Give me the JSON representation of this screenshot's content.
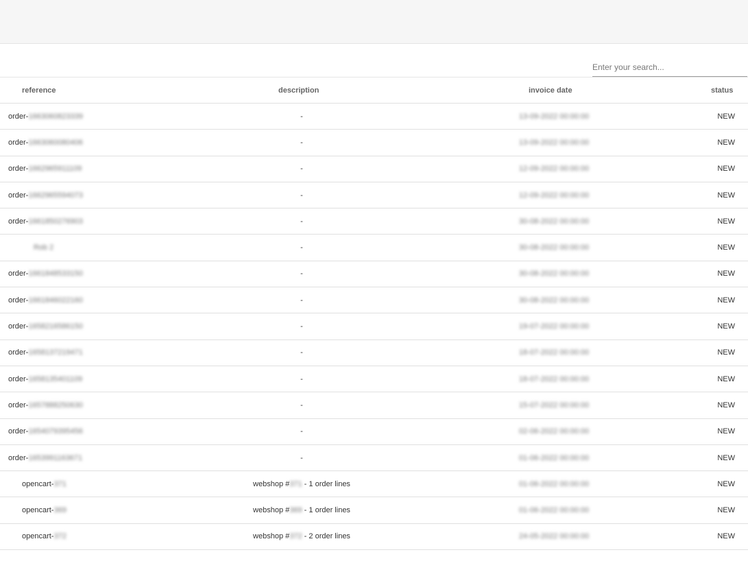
{
  "search": {
    "placeholder": "Enter your search..."
  },
  "table": {
    "columns": {
      "reference": "reference",
      "description": "description",
      "invoice_date": "invoice date",
      "status": "status"
    },
    "rows": [
      {
        "ref_prefix": "order-",
        "ref_hidden": "1663060823339",
        "desc": "-",
        "date": "13-09-2022 00:00:00",
        "status": "NEW"
      },
      {
        "ref_prefix": "order-",
        "ref_hidden": "1663060080406",
        "desc": "-",
        "date": "13-09-2022 00:00:00",
        "status": "NEW"
      },
      {
        "ref_prefix": "order-",
        "ref_hidden": "1662965911109",
        "desc": "-",
        "date": "12-09-2022 00:00:00",
        "status": "NEW"
      },
      {
        "ref_prefix": "order-",
        "ref_hidden": "1662965594073",
        "desc": "-",
        "date": "12-09-2022 00:00:00",
        "status": "NEW"
      },
      {
        "ref_prefix": "order-",
        "ref_hidden": "1661850276903",
        "desc": "-",
        "date": "30-08-2022 00:00:00",
        "status": "NEW"
      },
      {
        "ref_prefix": "",
        "ref_hidden": "Rob 2",
        "desc": "-",
        "date": "30-08-2022 00:00:00",
        "status": "NEW"
      },
      {
        "ref_prefix": "order-",
        "ref_hidden": "1661848533150",
        "desc": "-",
        "date": "30-08-2022 00:00:00",
        "status": "NEW"
      },
      {
        "ref_prefix": "order-",
        "ref_hidden": "1661846022160",
        "desc": "-",
        "date": "30-08-2022 00:00:00",
        "status": "NEW"
      },
      {
        "ref_prefix": "order-",
        "ref_hidden": "1658216586150",
        "desc": "-",
        "date": "19-07-2022 00:00:00",
        "status": "NEW"
      },
      {
        "ref_prefix": "order-",
        "ref_hidden": "1658137219471",
        "desc": "-",
        "date": "18-07-2022 00:00:00",
        "status": "NEW"
      },
      {
        "ref_prefix": "order-",
        "ref_hidden": "1658135401109",
        "desc": "-",
        "date": "18-07-2022 00:00:00",
        "status": "NEW"
      },
      {
        "ref_prefix": "order-",
        "ref_hidden": "1657888250630",
        "desc": "-",
        "date": "15-07-2022 00:00:00",
        "status": "NEW"
      },
      {
        "ref_prefix": "order-",
        "ref_hidden": "1654079395456",
        "desc": "-",
        "date": "02-06-2022 00:00:00",
        "status": "NEW"
      },
      {
        "ref_prefix": "order-",
        "ref_hidden": "1653991163671",
        "desc": "-",
        "date": "01-06-2022 00:00:00",
        "status": "NEW"
      },
      {
        "ref_prefix": "opencart-",
        "ref_hidden": "371",
        "desc_prefix": "webshop #",
        "desc_hidden": "371",
        "desc_suffix": " - 1 order lines",
        "date": "01-06-2022 00:00:00",
        "status": "NEW"
      },
      {
        "ref_prefix": "opencart-",
        "ref_hidden": "369",
        "desc_prefix": "webshop #",
        "desc_hidden": "369",
        "desc_suffix": " - 1 order lines",
        "date": "01-06-2022 00:00:00",
        "status": "NEW"
      },
      {
        "ref_prefix": "opencart-",
        "ref_hidden": "372",
        "desc_prefix": "webshop #",
        "desc_hidden": "372",
        "desc_suffix": " - 2 order lines",
        "date": "24-05-2022 00:00:00",
        "status": "NEW"
      }
    ]
  }
}
